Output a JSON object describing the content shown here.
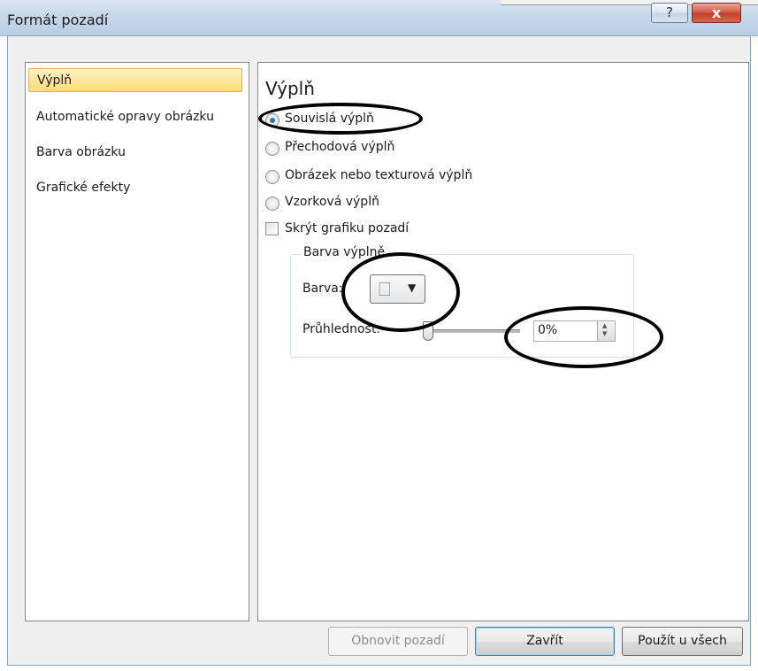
{
  "dialog": {
    "title": "Formát pozadí",
    "help_label": "?",
    "close_label": "x"
  },
  "nav": {
    "items": [
      {
        "label": "Výplň",
        "selected": true
      },
      {
        "label": "Automatické opravy obrázku",
        "selected": false
      },
      {
        "label": "Barva obrázku",
        "selected": false
      },
      {
        "label": "Grafické efekty",
        "selected": false
      }
    ]
  },
  "fill": {
    "heading": "Výplň",
    "options": [
      {
        "label": "Souvislá výplň",
        "checked": true
      },
      {
        "label": "Přechodová výplň",
        "checked": false
      },
      {
        "label": "Obrázek nebo texturová výplň",
        "checked": false
      },
      {
        "label": "Vzorková výplň",
        "checked": false
      }
    ],
    "hide_graphics_label": "Skrýt grafiku pozadí",
    "hide_graphics_checked": false,
    "group_label": "Barva výplně",
    "color_label": "Barva:",
    "transparency_label": "Průhlednost:",
    "transparency_value": "0%",
    "transparency_level": 0
  },
  "footer": {
    "reset_label": "Obnovit pozadí",
    "close_label": "Zavřít",
    "apply_all_label": "Použít u všech"
  },
  "colors": {
    "selection_highlight": "#ffd978",
    "radio_selected": "#2b6fc2",
    "annotation_ink": "#000000",
    "close_button": "#c3402a"
  },
  "icons": {
    "paint_bucket": "paint-bucket-icon",
    "dropdown": "chevron-down-icon",
    "spin_up": "spin-up-icon",
    "spin_down": "spin-down-icon"
  }
}
